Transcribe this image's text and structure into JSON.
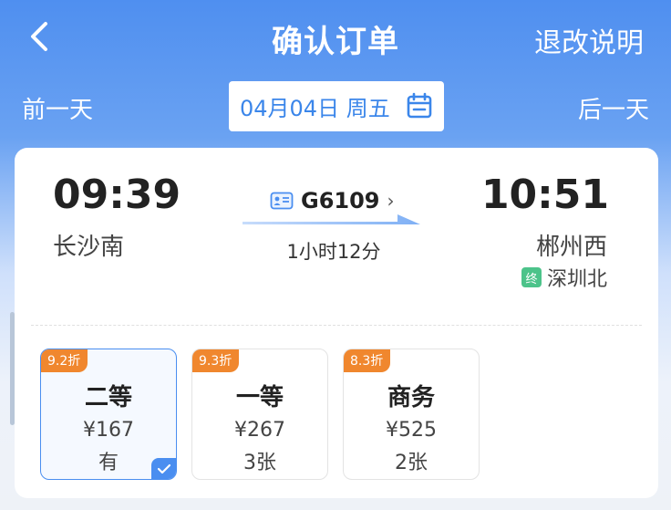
{
  "header": {
    "title": "确认订单",
    "refund_label": "退改说明"
  },
  "date_bar": {
    "prev_label": "前一天",
    "next_label": "后一天",
    "date": "04月04日 周五"
  },
  "trip": {
    "departure_time": "09:39",
    "departure_station": "长沙南",
    "arrival_time": "10:51",
    "arrival_station": "郴州西",
    "train_no": "G6109",
    "duration": "1小时12分",
    "terminal_badge": "终",
    "terminal_station": "深圳北"
  },
  "seats": [
    {
      "discount": "9.2折",
      "name": "二等",
      "price": "¥167",
      "availability": "有",
      "selected": true
    },
    {
      "discount": "9.3折",
      "name": "一等",
      "price": "¥267",
      "availability": "3张",
      "selected": false
    },
    {
      "discount": "8.3折",
      "name": "商务",
      "price": "¥525",
      "availability": "2张",
      "selected": false
    }
  ],
  "colors": {
    "primary": "#4f8ff0",
    "discount": "#f0872e",
    "terminal_badge": "#4cc38a"
  }
}
